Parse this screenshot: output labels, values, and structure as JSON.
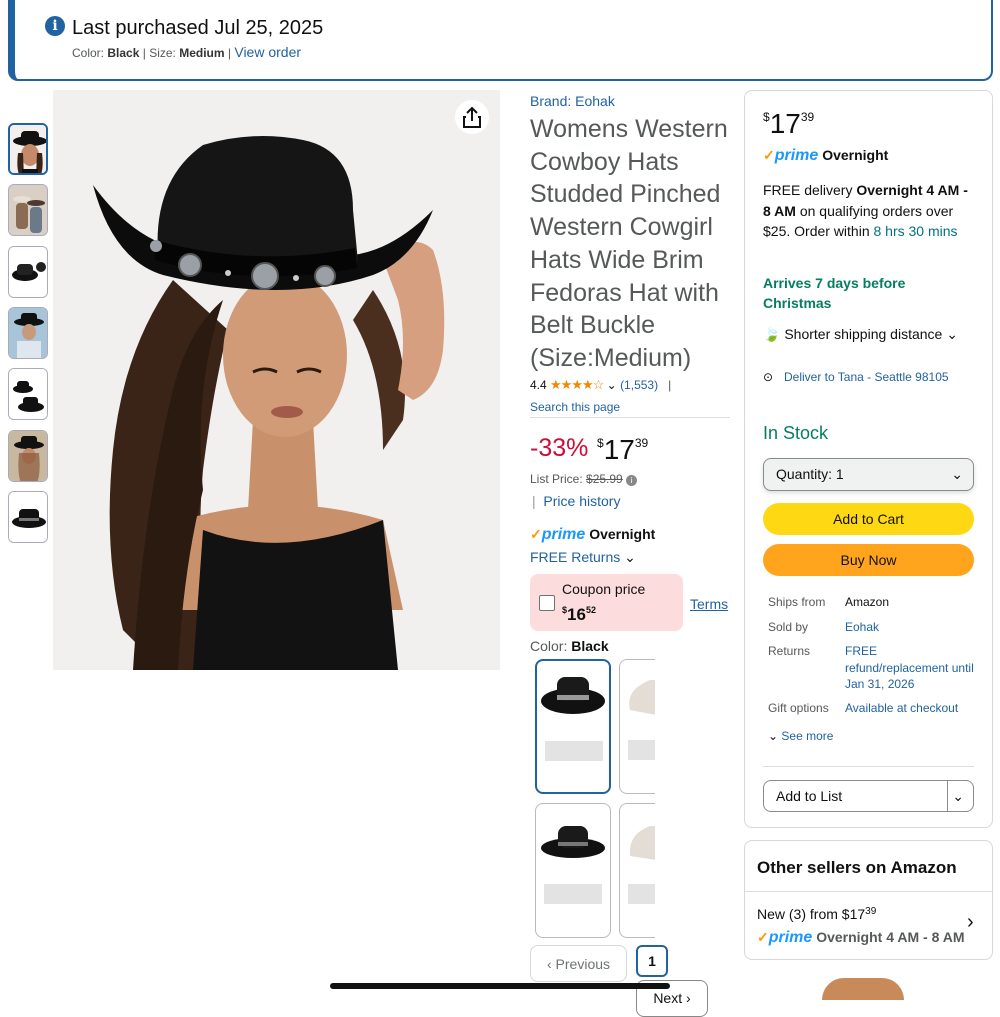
{
  "banner": {
    "title": "Last purchased Jul 25, 2025",
    "color_label": "Color:",
    "color_value": "Black",
    "size_label": "Size:",
    "size_value": "Medium",
    "view_order": "View order"
  },
  "product": {
    "brand": "Brand: Eohak",
    "title": "Womens Western Cowboy Hats Studded Pinched Western Cowgirl Hats Wide Brim Fedoras Hat with Belt Buckle (Size:Medium)",
    "rating": "4.4",
    "rating_value": 4.4,
    "review_count": "(1,553)",
    "search_page": "Search this page",
    "discount": "-33%",
    "price_dollars": "17",
    "price_cents": "39",
    "list_price_label": "List Price:",
    "list_price": "$25.99",
    "price_history": "Price history",
    "prime_label": "prime",
    "prime_speed": "Overnight",
    "free_returns": "FREE Returns",
    "coupon_label": "Coupon price",
    "coupon_dollars": "16",
    "coupon_cents": "52",
    "terms": "Terms",
    "color_label": "Color:",
    "color_value": "Black"
  },
  "pager": {
    "previous": "Previous",
    "current": "1",
    "next": "Next"
  },
  "buybox": {
    "price_dollars": "17",
    "price_cents": "39",
    "prime_label": "prime",
    "prime_speed": "Overnight",
    "delivery_free": "FREE delivery",
    "delivery_speed": "Overnight",
    "delivery_window": "4 AM - 8 AM",
    "delivery_rest": "on qualifying orders over $25. Order within",
    "countdown": "8 hrs 30 mins",
    "arrives": "Arrives 7 days before Christmas",
    "shorter_shipping": "Shorter shipping distance",
    "deliver_to": "Deliver to Tana - Seattle 98105",
    "stock": "In Stock",
    "quantity": "Quantity:  1",
    "add_to_cart": "Add to Cart",
    "buy_now": "Buy Now",
    "ships_from_label": "Ships from",
    "ships_from": "Amazon",
    "sold_by_label": "Sold by",
    "sold_by": "Eohak",
    "returns_label": "Returns",
    "returns": "FREE refund/replacement until Jan 31, 2026",
    "gift_label": "Gift options",
    "gift": "Available at checkout",
    "see_more": "See more",
    "add_to_list": "Add to List"
  },
  "other_sellers": {
    "heading": "Other sellers on Amazon",
    "new_text": "New (3) from",
    "price_dollars": "$17",
    "price_cents": "39",
    "prime_label": "prime",
    "prime_speed": "Overnight 4 AM - 8 AM"
  },
  "colors": {
    "link": "#2162a1",
    "deal_red": "#cc0c39",
    "stock_green": "#067d62",
    "cart_yellow": "#ffd814",
    "buy_orange": "#ffa41c",
    "prime_blue": "#1a98ff"
  }
}
